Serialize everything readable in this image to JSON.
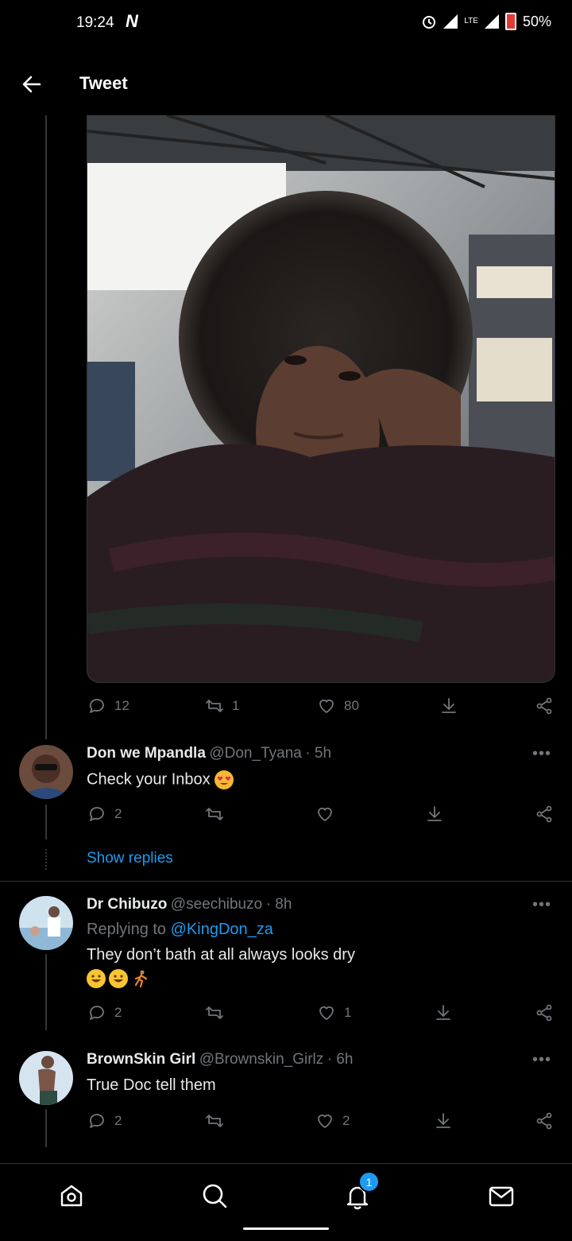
{
  "status_bar": {
    "time": "19:24",
    "app_glyph": "N",
    "network": "LTE",
    "battery": "50%"
  },
  "header": {
    "title": "Tweet"
  },
  "tweet": {
    "stats": {
      "replies": "12",
      "retweets": "1",
      "likes": "80"
    }
  },
  "replies": [
    {
      "name": "Don we Mpandla",
      "handle": "@Don_Tyana",
      "time": "· 5h",
      "text": "Check your Inbox",
      "emojis": [
        "heart-eyes-emoji"
      ],
      "replies": "2",
      "retweets": "",
      "likes": "",
      "show_replies": "Show replies"
    },
    {
      "name": "Dr Chibuzo",
      "handle": "@seechibuzo",
      "time": "· 8h",
      "replying_to_prefix": "Replying to",
      "replying_to": "@KingDon_za",
      "text": "They don’t bath at all  always looks dry",
      "emojis": [
        "grinning-emoji",
        "grinning-emoji",
        "runner-emoji"
      ],
      "replies": "2",
      "retweets": "",
      "likes": "1"
    },
    {
      "name": "BrownSkin Girl",
      "handle": "@Brownskin_Girlz",
      "time": "· 6h",
      "text": "True Doc tell them",
      "replies": "2",
      "retweets": "",
      "likes": "2"
    }
  ],
  "more_label": "•••",
  "bottom_nav": {
    "items": [
      "home-icon",
      "search-icon",
      "notifications-icon",
      "messages-icon"
    ],
    "notification_count": "1"
  },
  "colors": {
    "accent": "#1d9bf0",
    "background": "#000000",
    "secondary_text": "#71767b"
  }
}
